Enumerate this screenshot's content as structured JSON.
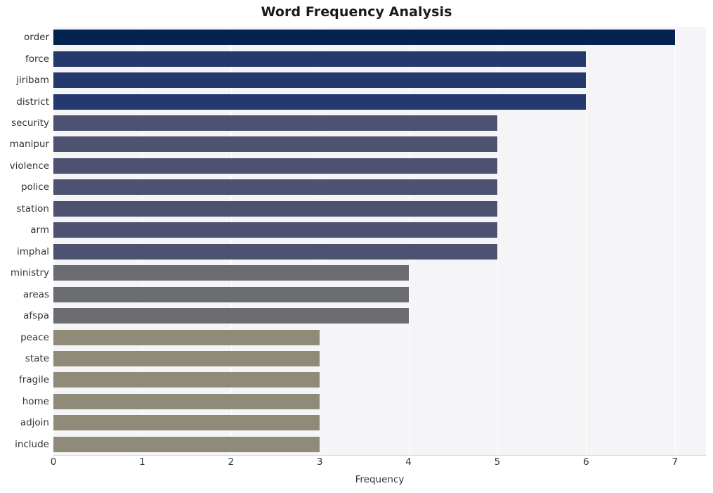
{
  "chart_data": {
    "type": "bar",
    "orientation": "horizontal",
    "title": "Word Frequency Analysis",
    "xlabel": "Frequency",
    "ylabel": "",
    "xlim": [
      0,
      7.35
    ],
    "xticks": [
      0,
      1,
      2,
      3,
      4,
      5,
      6,
      7
    ],
    "xtick_labels": [
      "0",
      "1",
      "2",
      "3",
      "4",
      "5",
      "6",
      "7"
    ],
    "grid": "vertical-white-on-light-panel",
    "legend": "none",
    "categories": [
      "order",
      "force",
      "jiribam",
      "district",
      "security",
      "manipur",
      "violence",
      "police",
      "station",
      "arm",
      "imphal",
      "ministry",
      "areas",
      "afspa",
      "peace",
      "state",
      "fragile",
      "home",
      "adjoin",
      "include"
    ],
    "values": [
      7,
      6,
      6,
      6,
      5,
      5,
      5,
      5,
      5,
      5,
      5,
      4,
      4,
      4,
      3,
      3,
      3,
      3,
      3,
      3
    ],
    "bar_colors": [
      "#042450",
      "#25396d",
      "#25396d",
      "#25396d",
      "#4c5270",
      "#4c5270",
      "#4c5270",
      "#4c5270",
      "#4c5270",
      "#4c5270",
      "#4c5270",
      "#6a6c70",
      "#6a6c70",
      "#6a6c70",
      "#908a79",
      "#908a79",
      "#908a79",
      "#908a79",
      "#908a79",
      "#908a79"
    ]
  },
  "style": {
    "plot_background": "#f5f5f7",
    "figure_background": "#ffffff",
    "gridline_color": "#ffffff",
    "axis_text_color": "#30343b",
    "title_color": "#1a1a1a"
  }
}
